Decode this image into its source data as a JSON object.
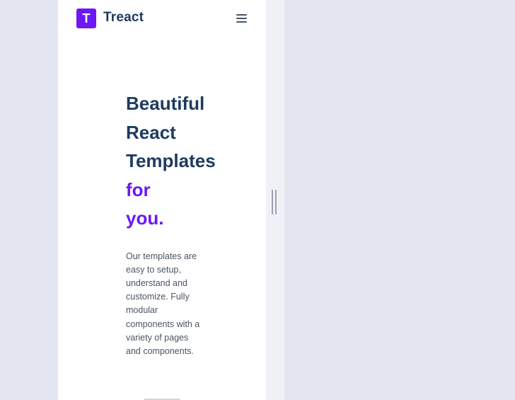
{
  "brand": {
    "logo_letter": "T",
    "name": "Treact"
  },
  "navbar": {
    "menu_icon": "hamburger-menu-icon"
  },
  "hero": {
    "title_lines": [
      "Beautiful",
      "React",
      "Templates"
    ],
    "title_accent_lines": [
      "for",
      "you."
    ],
    "description": "Our templates are easy to setup, understand and customize. Fully modular components with a variety of pages and components."
  },
  "colors": {
    "accent": "#6d17f5",
    "heading": "#1e3a5f",
    "body_text": "#4b5563",
    "page_background": "#e3e6f1"
  }
}
